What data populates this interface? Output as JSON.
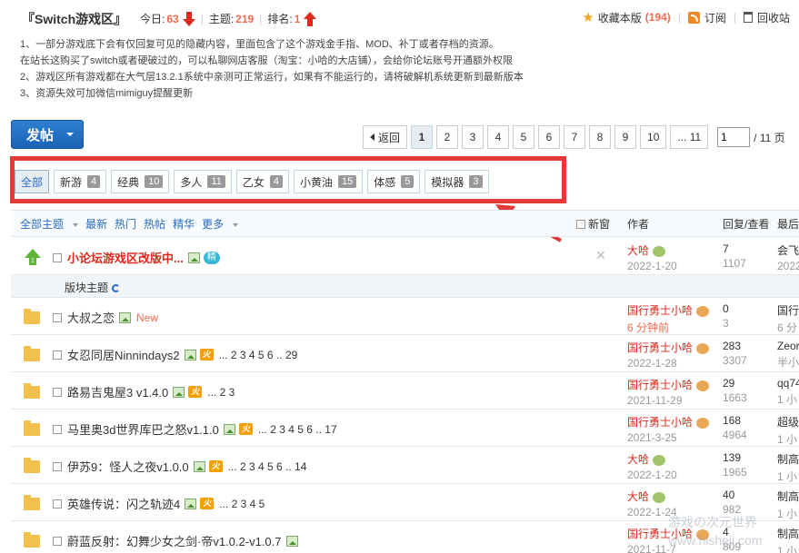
{
  "header": {
    "forum_title": "『Switch游戏区』",
    "today_label": "今日:",
    "today_value": "63",
    "topics_label": "主题:",
    "topics_value": "219",
    "rank_label": "排名:",
    "rank_value": "1",
    "favorite_label": "收藏本版",
    "favorite_count": "(194)",
    "subscribe_label": "订阅",
    "recycle_label": "回收站"
  },
  "notes": [
    "1、一部分游戏底下会有仅回复可见的隐藏内容，里面包含了这个游戏金手指、MOD、补丁或者存档的资源。",
    "在站长这购买了switch或者硬破过的，可以私聊网店客服（淘宝：小哈的大店铺），会给你论坛账号开通额外权限",
    "2、游戏区所有游戏都在大气层13.2.1系统中亲测可正常运行，如果有不能运行的，请将破解机系统更新到最新版本",
    "3、资源失效可加微信mimiguy提醒更新"
  ],
  "post_button": "发帖",
  "pager": {
    "back": "返回",
    "pages": [
      "1",
      "2",
      "3",
      "4",
      "5",
      "6",
      "7",
      "8",
      "9",
      "10",
      "... 11"
    ],
    "current": "1",
    "input_value": "1",
    "total": "/ 11 页"
  },
  "tabs": [
    {
      "label": "全部",
      "count": ""
    },
    {
      "label": "新游",
      "count": "4"
    },
    {
      "label": "经典",
      "count": "10"
    },
    {
      "label": "多人",
      "count": "11"
    },
    {
      "label": "乙女",
      "count": "4"
    },
    {
      "label": "小黄油",
      "count": "15"
    },
    {
      "label": "体感",
      "count": "5"
    },
    {
      "label": "模拟器",
      "count": "3"
    }
  ],
  "table_header": {
    "all_topics": "全部主题",
    "latest": "最新",
    "hot": "热门",
    "hot_posts": "热帖",
    "digest": "精华",
    "more": "更多",
    "new_window": "新窗",
    "author": "作者",
    "reply_view": "回复/查看",
    "last_post": "最后"
  },
  "sticky": {
    "title": "小论坛游戏区改版中...",
    "jing": "精",
    "author": "大哈",
    "date": "2022-1-20",
    "replies": "7",
    "views": "1107",
    "last_name": "会飞",
    "last_time": "2022"
  },
  "section_label": "版块主题",
  "threads": [
    {
      "title": "大叔之恋",
      "new_tag": "New",
      "hot": "",
      "pages": "",
      "author": "国行勇士小哈",
      "date": "6 分钟前",
      "replies": "0",
      "views": "3",
      "last_name": "国行",
      "last_time": "6 分"
    },
    {
      "title": "女忍同居Ninnindays2",
      "new_tag": "",
      "hot": "火",
      "pages": "... 2 3 4 5 6 .. 29",
      "author": "国行勇士小哈",
      "date": "2022-1-28",
      "replies": "283",
      "views": "3307",
      "last_name": "Zeor",
      "last_time": "半小"
    },
    {
      "title": "路易吉鬼屋3 v1.4.0",
      "new_tag": "",
      "hot": "火",
      "pages": "... 2 3",
      "author": "国行勇士小哈",
      "date": "2021-11-29",
      "replies": "29",
      "views": "1663",
      "last_name": "qq74",
      "last_time": "1 小"
    },
    {
      "title": "马里奥3d世界库巴之怒v1.1.0",
      "new_tag": "",
      "hot": "火",
      "pages": "... 2 3 4 5 6 .. 17",
      "author": "国行勇士小哈",
      "date": "2021-3-25",
      "replies": "168",
      "views": "4964",
      "last_name": "超级",
      "last_time": "1 小"
    },
    {
      "title": "伊苏9：怪人之夜v1.0.0",
      "new_tag": "",
      "hot": "火",
      "pages": "... 2 3 4 5 6 .. 14",
      "author": "大哈",
      "date": "2022-1-20",
      "replies": "139",
      "views": "1965",
      "last_name": "制高",
      "last_time": "1 小"
    },
    {
      "title": "英雄传说：闪之轨迹4",
      "new_tag": "",
      "hot": "火",
      "pages": "... 2 3 4 5",
      "author": "大哈",
      "date": "2022-1-24",
      "replies": "40",
      "views": "982",
      "last_name": "制高",
      "last_time": "1 小"
    },
    {
      "title": "蔚蓝反射：幻舞少女之剑·帝v1.0.2-v1.0.7",
      "new_tag": "",
      "hot": "",
      "pages": "",
      "author": "国行勇士小哈",
      "date": "2021-11-7",
      "replies": "4",
      "views": "809",
      "last_name": "制高",
      "last_time": "1 小"
    }
  ],
  "watermark": [
    "游戏の次元世界",
    "www.hisheji.com"
  ]
}
